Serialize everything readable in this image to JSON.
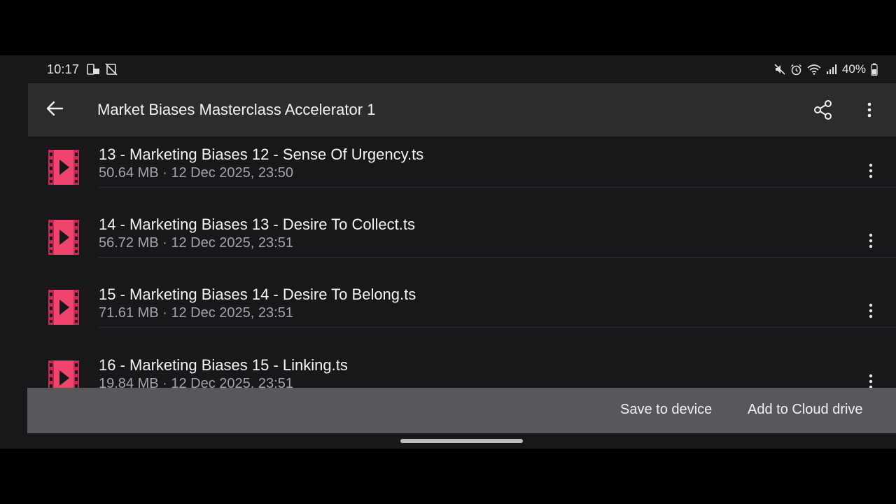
{
  "status_bar": {
    "time": "10:17",
    "battery_percent": "40%",
    "left_icons": [
      "download-icon",
      "sync-off-icon"
    ],
    "right_icons": [
      "mute-icon",
      "alarm-icon",
      "wifi-icon",
      "signal-icon",
      "battery-icon"
    ]
  },
  "app_bar": {
    "title": "Market Biases Masterclass Accelerator 1",
    "back_icon": "arrow-left-icon",
    "share_icon": "share-icon",
    "more_icon": "more-vertical-icon"
  },
  "colors": {
    "background": "#18171a",
    "app_bar": "#2c2c2e",
    "action_bar": "#58575c",
    "video_icon": "#f0446e"
  },
  "files": [
    {
      "name": "13 - Marketing Biases 12 - Sense Of Urgency.ts",
      "size": "50.64 MB",
      "date": "12 Dec 2025, 23:50",
      "meta": "50.64 MB · 12 Dec 2025, 23:50"
    },
    {
      "name": "14 - Marketing Biases 13 - Desire To Collect.ts",
      "size": "56.72 MB",
      "date": "12 Dec 2025, 23:51",
      "meta": "56.72 MB · 12 Dec 2025, 23:51"
    },
    {
      "name": "15 - Marketing Biases 14 - Desire To Belong.ts",
      "size": "71.61 MB",
      "date": "12 Dec 2025, 23:51",
      "meta": "71.61 MB · 12 Dec 2025, 23:51"
    },
    {
      "name": "16 - Marketing Biases 15 - Linking.ts",
      "size": "19.84 MB",
      "date": "12 Dec 2025, 23:51",
      "meta": "19.84 MB · 12 Dec 2025, 23:51"
    }
  ],
  "actions": {
    "save_label": "Save to device",
    "cloud_label": "Add to Cloud drive"
  }
}
